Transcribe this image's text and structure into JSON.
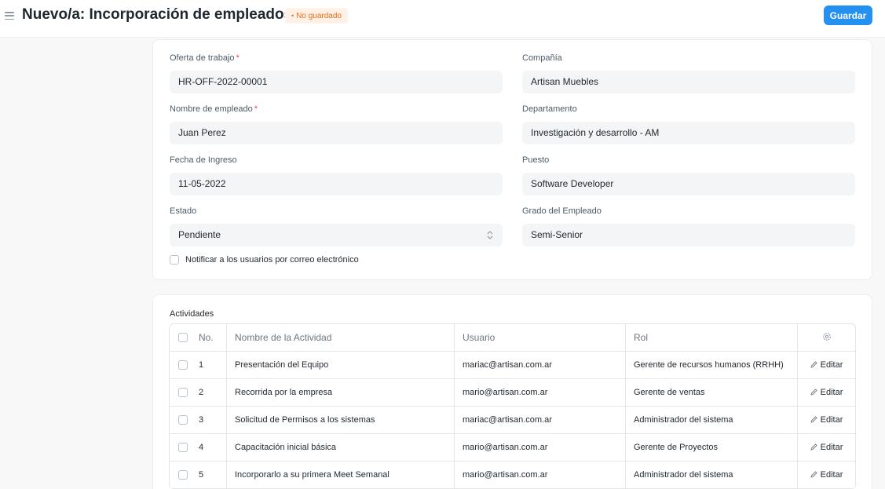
{
  "header": {
    "title": "Nuevo/a: Incorporación de empleados",
    "status": "No guardado",
    "save_label": "Guardar"
  },
  "form": {
    "job_offer": {
      "label": "Oferta de trabajo",
      "value": "HR-OFF-2022-00001",
      "required": "*"
    },
    "company": {
      "label": "Compañía",
      "value": "Artisan Muebles"
    },
    "employee_name": {
      "label": "Nombre de empleado",
      "value": "Juan Perez",
      "required": "*"
    },
    "department": {
      "label": "Departamento",
      "value": "Investigación y desarrollo - AM"
    },
    "date_of_joining": {
      "label": "Fecha de Ingreso",
      "value": "11-05-2022"
    },
    "designation": {
      "label": "Puesto",
      "value": "Software Developer"
    },
    "status": {
      "label": "Estado",
      "value": "Pendiente"
    },
    "grade": {
      "label": "Grado del Empleado",
      "value": "Semi-Senior"
    },
    "notify_label": "Notificar a los usuarios por correo electrónico"
  },
  "activities": {
    "label": "Actividades",
    "columns": {
      "no": "No.",
      "name": "Nombre de la Actividad",
      "user": "Usuario",
      "role": "Rol"
    },
    "edit_label": "Editar",
    "rows": [
      {
        "no": "1",
        "name": "Presentación del Equipo",
        "user": "mariac@artisan.com.ar",
        "role": "Gerente de recursos humanos (RRHH)"
      },
      {
        "no": "2",
        "name": "Recorrida por la empresa",
        "user": "mario@artisan.com.ar",
        "role": "Gerente de ventas"
      },
      {
        "no": "3",
        "name": "Solicitud de Permisos a los sistemas",
        "user": "mariac@artisan.com.ar",
        "role": "Administrador del sistema"
      },
      {
        "no": "4",
        "name": "Capacitación inicial básica",
        "user": "mario@artisan.com.ar",
        "role": "Gerente de Proyectos"
      },
      {
        "no": "5",
        "name": "Incorporarlo a su primera Meet Semanal",
        "user": "mario@artisan.com.ar",
        "role": "Administrador del sistema"
      }
    ]
  },
  "icons": {
    "menu": "hamburger-icon",
    "select": "chevron-up-down-icon",
    "settings": "gear-icon",
    "edit": "pencil-icon"
  },
  "colors": {
    "primary": "#2490ef",
    "status_bg": "#fff1e7",
    "status_text": "#e86c13",
    "required": "#e24c4c"
  }
}
